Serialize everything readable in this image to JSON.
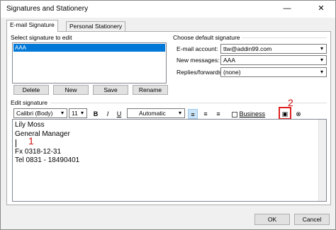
{
  "window": {
    "title": "Signatures and Stationery",
    "minimize": "—",
    "close": "✕"
  },
  "tabs": [
    {
      "label": "E-mail Signature",
      "active": true
    },
    {
      "label": "Personal Stationery",
      "active": false
    }
  ],
  "select_signature": {
    "label": "Select signature to edit",
    "items": [
      "AAA"
    ],
    "buttons": {
      "delete": "Delete",
      "new": "New",
      "save": "Save",
      "rename": "Rename"
    }
  },
  "defaults": {
    "label": "Choose default signature",
    "email_account": {
      "label": "E-mail account:",
      "value": "ttw@addin99.com"
    },
    "new_messages": {
      "label": "New messages:",
      "value": "AAA"
    },
    "replies": {
      "label": "Replies/forwards:",
      "value": "(none)"
    }
  },
  "edit": {
    "label": "Edit signature",
    "font": "Calibri (Body)",
    "size": "11",
    "bold": "B",
    "italic": "I",
    "underline": "U",
    "color": "Automatic",
    "business_card": "Business Card",
    "lines": [
      "Lily Moss",
      "General Manager",
      "",
      "Fx 0318-12-31",
      "Tel 0831 - 18490401"
    ]
  },
  "annotations": {
    "one": "1",
    "two": "2"
  },
  "footer": {
    "ok": "OK",
    "cancel": "Cancel"
  },
  "colors": {
    "selection": "#0078d7",
    "annotation": "#e02020"
  }
}
